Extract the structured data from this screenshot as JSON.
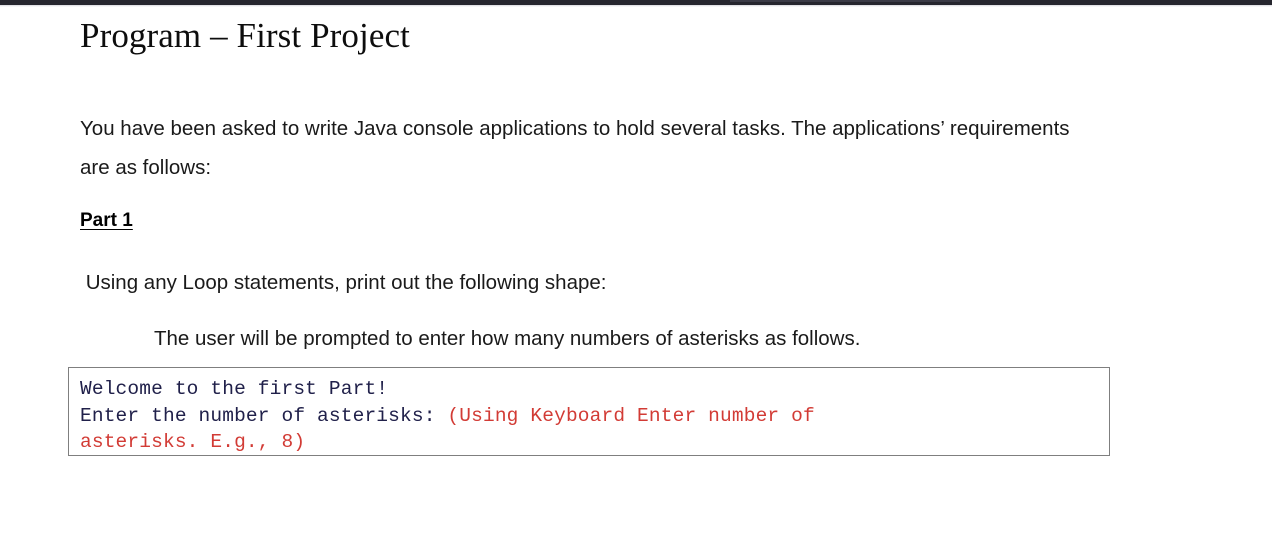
{
  "window": {
    "chrome_bar": "dark-title-bar"
  },
  "document": {
    "title": "Program – First Project",
    "intro_paragraph": "You have been asked to write Java console applications to hold several tasks. The applications’ requirements are as follows:",
    "part_heading": "Part 1",
    "loop_instruction": " Using any Loop statements, print out the following shape:",
    "prompt_instruction": "The user will be prompted to enter how many numbers of asterisks as follows."
  },
  "code_box": {
    "line1": "Welcome to the first Part!",
    "line2_prefix": "Enter the number of asterisks: ",
    "line2_red": "(Using Keyboard Enter number of",
    "line3_red": "asterisks. E.g., 8)",
    "colors": {
      "normal_text": "#20204a",
      "highlight_text": "#d23b35",
      "border": "#7f7f7f"
    }
  }
}
